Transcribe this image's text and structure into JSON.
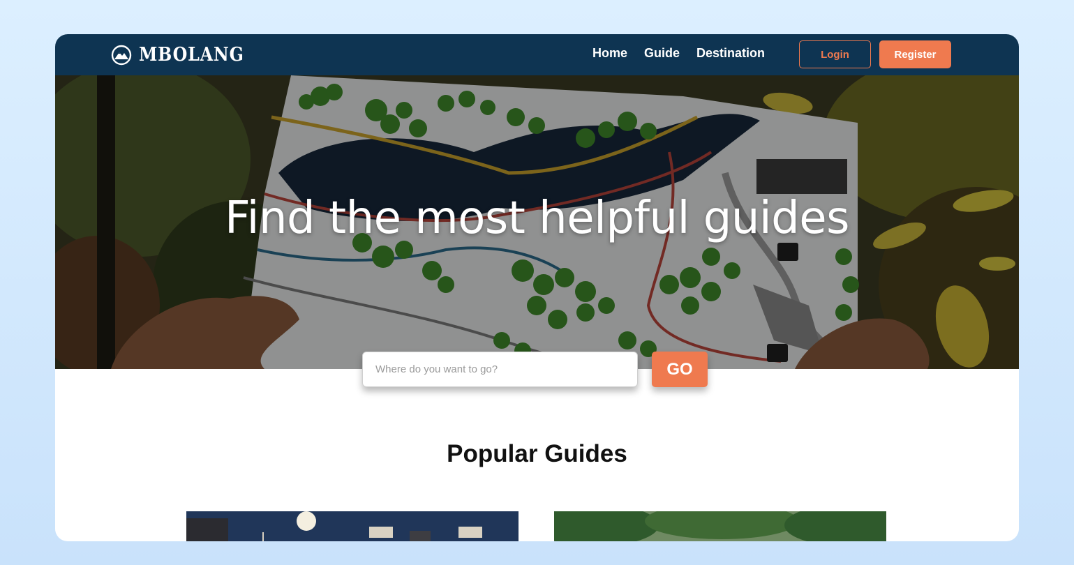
{
  "brand": {
    "name": "MBOLANG",
    "logo_icon": "mountain-icon"
  },
  "nav": {
    "links": [
      {
        "label": "Home"
      },
      {
        "label": "Guide"
      },
      {
        "label": "Destination"
      }
    ],
    "login_label": "Login",
    "register_label": "Register"
  },
  "hero": {
    "title": "Find the most helpful guides",
    "search_placeholder": "Where do you want to go?",
    "go_label": "GO"
  },
  "popular": {
    "title": "Popular Guides"
  },
  "colors": {
    "navbar": "#0e3452",
    "accent": "#ef7a4f",
    "background": "#d4e9fd"
  }
}
